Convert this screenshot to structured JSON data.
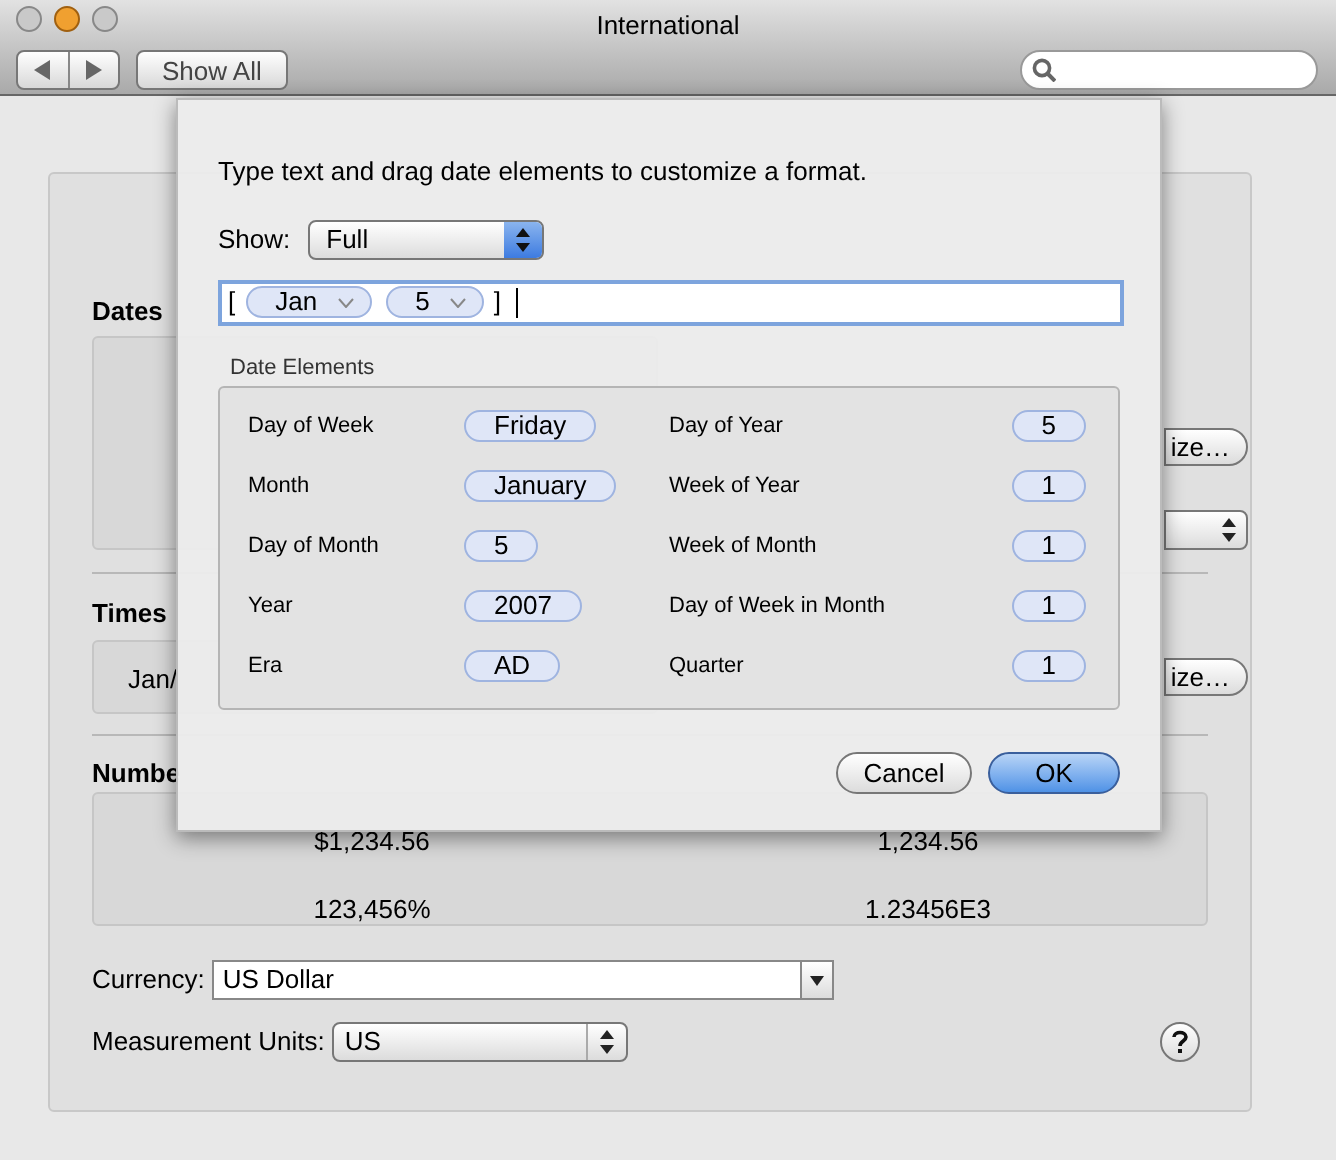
{
  "window": {
    "title": "International"
  },
  "toolbar": {
    "show_all": "Show All"
  },
  "panel": {
    "dates": {
      "label": "Dates",
      "customize": "ize…"
    },
    "times": {
      "label": "Times",
      "sample": "Jan/",
      "customize": "ize…"
    },
    "numbers": {
      "label": "Numbe",
      "values": [
        "$1,234.56",
        "1,234.56",
        "123,456%",
        "1.23456E3"
      ]
    },
    "currency": {
      "label": "Currency:",
      "value": "US Dollar"
    },
    "measurement": {
      "label": "Measurement Units:",
      "value": "US"
    }
  },
  "sheet": {
    "instruction": "Type text and drag date elements to customize a format.",
    "show": {
      "label": "Show:",
      "value": "Full"
    },
    "format_tokens": [
      {
        "kind": "text",
        "text": "["
      },
      {
        "kind": "element",
        "text": "Jan"
      },
      {
        "kind": "element",
        "text": "5"
      },
      {
        "kind": "text",
        "text": "]"
      }
    ],
    "elements_title": "Date Elements",
    "left_column": [
      {
        "label": "Day of Week",
        "value": "Friday"
      },
      {
        "label": "Month",
        "value": "January"
      },
      {
        "label": "Day of Month",
        "value": "5"
      },
      {
        "label": "Year",
        "value": "2007"
      },
      {
        "label": "Era",
        "value": "AD"
      }
    ],
    "right_column": [
      {
        "label": "Day of Year",
        "value": "5"
      },
      {
        "label": "Week of Year",
        "value": "1"
      },
      {
        "label": "Week of Month",
        "value": "1"
      },
      {
        "label": "Day of Week in Month",
        "value": "1"
      },
      {
        "label": "Quarter",
        "value": "1"
      }
    ],
    "buttons": [
      {
        "label": "Cancel",
        "default": false
      },
      {
        "label": "OK",
        "default": true
      }
    ]
  }
}
